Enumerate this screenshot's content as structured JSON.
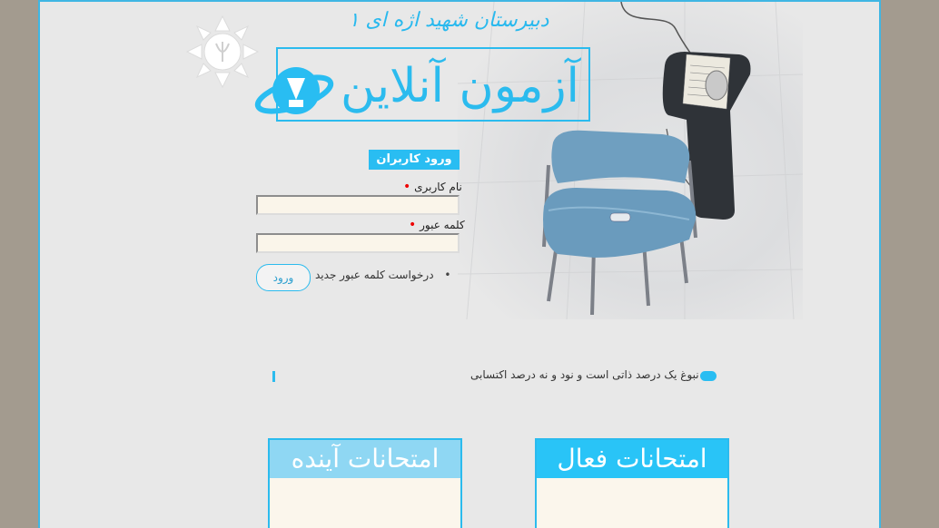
{
  "header": {
    "school_title": "دبیرستان شهید اژه ای ۱",
    "logo_text": "آزمون آنلاین"
  },
  "login": {
    "title": "ورود کاربران",
    "username_label": "نام کاربری",
    "password_label": "کلمه عبور",
    "required_marker": "•",
    "submit_label": "ورود",
    "forgot_link": "درخواست کلمه عبور جدید",
    "bullet": "•"
  },
  "ticker": {
    "text": "نبوغ یک درصد ذاتی است و نود و نه درصد اکتسابی"
  },
  "panels": {
    "future_title": "امتحانات آینده",
    "active_title": "امتحانات فعال"
  },
  "colors": {
    "accent": "#29bdf2",
    "background": "#a39b8f",
    "page": "#e8e8e8"
  }
}
